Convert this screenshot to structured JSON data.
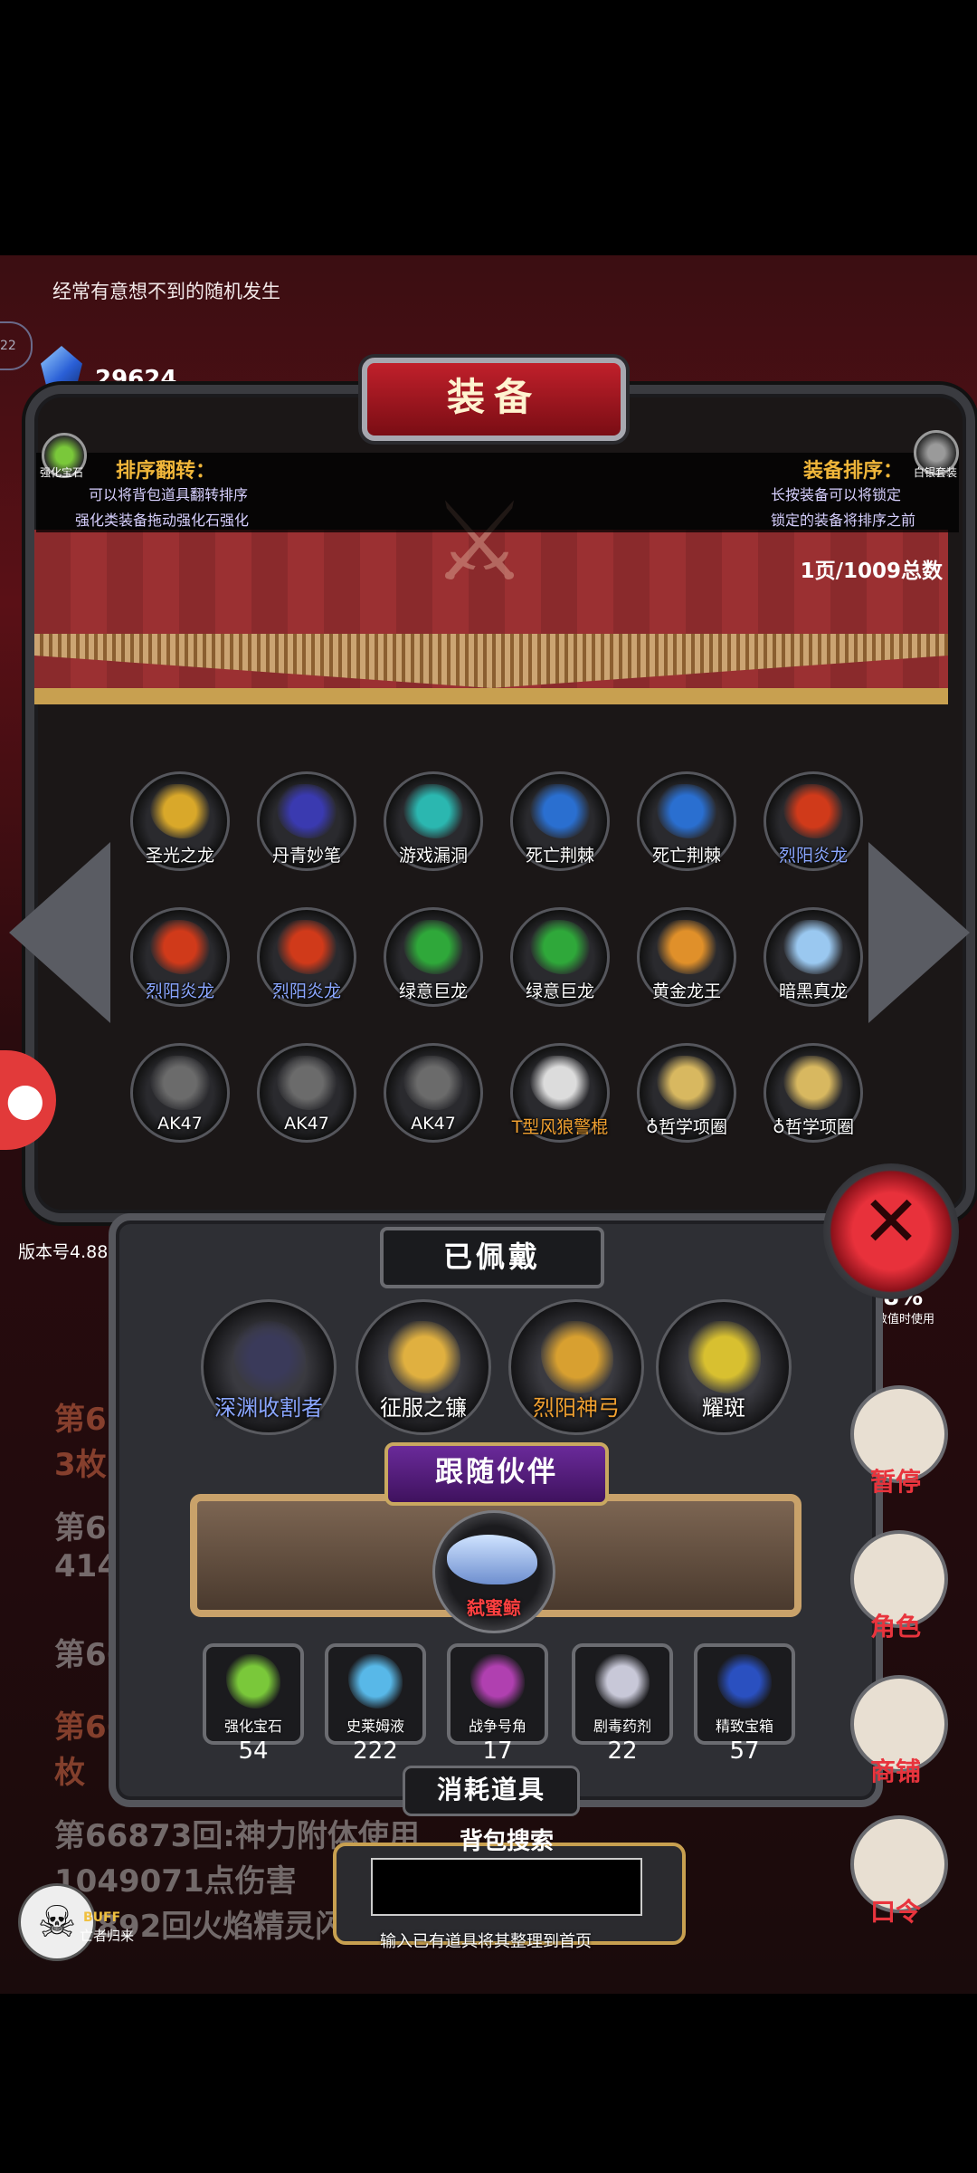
{
  "top_bar": {
    "marquee": "经常有意想不到的随机发生",
    "gem_label": "宝石",
    "currency_value": "29624",
    "left_badge": "22"
  },
  "header": {
    "title": "装备",
    "left_hint": {
      "heading": "排序翻转：",
      "line1": "可以将背包道具翻转排序",
      "line2": "强化类装备拖动强化石强化",
      "icon_label": "强化宝石"
    },
    "right_hint": {
      "heading": "装备排序：",
      "line1": "长按装备可以将锁定",
      "line2": "锁定的装备将排序之前",
      "icon_label": "白银套装"
    },
    "page_count": "1页/1009总数"
  },
  "inventory": {
    "rows": [
      [
        {
          "label": "圣光之龙",
          "color": "#ffffff",
          "icon": "golden-dragon-icon",
          "tint": "#d9a82a"
        },
        {
          "label": "丹青妙笔",
          "color": "#ffffff",
          "icon": "brush-icon",
          "tint": "#3a3ab0"
        },
        {
          "label": "游戏漏洞",
          "color": "#ffffff",
          "icon": "portal-icon",
          "tint": "#2bb7b0"
        },
        {
          "label": "死亡荆棘",
          "color": "#ffffff",
          "icon": "thorn-whip-icon",
          "tint": "#2a6fd0"
        },
        {
          "label": "死亡荆棘",
          "color": "#ffffff",
          "icon": "thorn-whip-icon",
          "tint": "#2a6fd0"
        },
        {
          "label": "烈阳炎龙",
          "color": "#8aa6ff",
          "icon": "fire-dragon-icon",
          "tint": "#d03a1a"
        }
      ],
      [
        {
          "label": "烈阳炎龙",
          "color": "#8aa6ff",
          "icon": "fire-dragon-icon",
          "tint": "#d03a1a"
        },
        {
          "label": "烈阳炎龙",
          "color": "#8aa6ff",
          "icon": "fire-dragon-icon",
          "tint": "#d03a1a"
        },
        {
          "label": "绿意巨龙",
          "color": "#ffffff",
          "icon": "green-dragon-icon",
          "tint": "#2fa83a"
        },
        {
          "label": "绿意巨龙",
          "color": "#ffffff",
          "icon": "green-dragon-icon",
          "tint": "#2fa83a"
        },
        {
          "label": "黄金龙王",
          "color": "#ffffff",
          "icon": "gold-dragon-king-icon",
          "tint": "#e0902a"
        },
        {
          "label": "暗黑真龙",
          "color": "#ffffff",
          "icon": "ice-dragon-icon",
          "tint": "#9ac8f0"
        }
      ],
      [
        {
          "label": "AK47",
          "color": "#ffffff",
          "icon": "rifle-icon",
          "tint": "#6b6b6b"
        },
        {
          "label": "AK47",
          "color": "#ffffff",
          "icon": "rifle-icon",
          "tint": "#6b6b6b"
        },
        {
          "label": "AK47",
          "color": "#ffffff",
          "icon": "rifle-icon",
          "tint": "#6b6b6b"
        },
        {
          "label": "T型风狼警棍",
          "color": "#f0a030",
          "icon": "baton-icon",
          "tint": "#dcdcdc"
        },
        {
          "label": "♁哲学项圈",
          "color": "#ffffff",
          "icon": "collar-icon",
          "tint": "#d8b860"
        },
        {
          "label": "♁哲学项圈",
          "color": "#ffffff",
          "icon": "collar-icon",
          "tint": "#d8b860"
        }
      ]
    ]
  },
  "equipped": {
    "title": "已佩戴",
    "items": [
      {
        "label": "深渊收割者",
        "color": "#8aa6ff",
        "icon": "reaper-icon",
        "tint": "#3a3a5a"
      },
      {
        "label": "征服之镰",
        "color": "#ffffff",
        "icon": "scythe-icon",
        "tint": "#e0b040"
      },
      {
        "label": "烈阳神弓",
        "color": "#f0a030",
        "icon": "bow-icon",
        "tint": "#d8a030"
      },
      {
        "label": "耀斑",
        "color": "#ffffff",
        "icon": "flare-sword-icon",
        "tint": "#d8c030"
      }
    ]
  },
  "companion": {
    "title": "跟随伙伴",
    "pet_label": "弑蜜鲸"
  },
  "consumables": {
    "title": "消耗道具",
    "items": [
      {
        "name": "强化宝石",
        "count": "54",
        "icon": "enhance-gem-icon",
        "tint": "#7ac83a"
      },
      {
        "name": "史莱姆液",
        "count": "222",
        "icon": "potion-bottle-icon",
        "tint": "#58b8e8"
      },
      {
        "name": "战争号角",
        "count": "17",
        "icon": "war-horn-icon",
        "tint": "#b040b0"
      },
      {
        "name": "剧毒药剂",
        "count": "22",
        "icon": "poison-flask-icon",
        "tint": "#c8c8d8"
      },
      {
        "name": "精致宝箱",
        "count": "57",
        "icon": "treasure-chest-icon",
        "tint": "#2a50c0"
      }
    ]
  },
  "search": {
    "label": "背包搜索",
    "value": "",
    "hint": "输入已有道具将其整理到首页"
  },
  "misc": {
    "version": "版本号4.88",
    "stat_value": "78%",
    "stat_caption": "其数值时使用",
    "close_symbol": "✕"
  },
  "side_buttons": [
    {
      "label": "暂停",
      "icon": "dice-icon"
    },
    {
      "label": "角色",
      "icon": "hooded-figure-icon"
    },
    {
      "label": "商铺",
      "icon": "shop-icon"
    },
    {
      "label": "口令",
      "icon": "scroll-icon"
    }
  ],
  "background_log": [
    {
      "text": "第6",
      "red": true
    },
    {
      "text": "3枚",
      "red": true
    },
    {
      "text": "第66",
      "red": false
    },
    {
      "text": "414",
      "red": false
    },
    {
      "text": "第66",
      "red": false
    },
    {
      "text": "第66",
      "red": true
    },
    {
      "text": "枚",
      "red": true
    },
    {
      "text": "第66873回:神力附体使用",
      "red": false
    },
    {
      "text": "1049071点伤害",
      "red": false
    },
    {
      "text": "66892回火焰精灵闪避并患害",
      "red": false
    }
  ],
  "buff": {
    "label": "BUFF",
    "name": "亡者归来"
  }
}
